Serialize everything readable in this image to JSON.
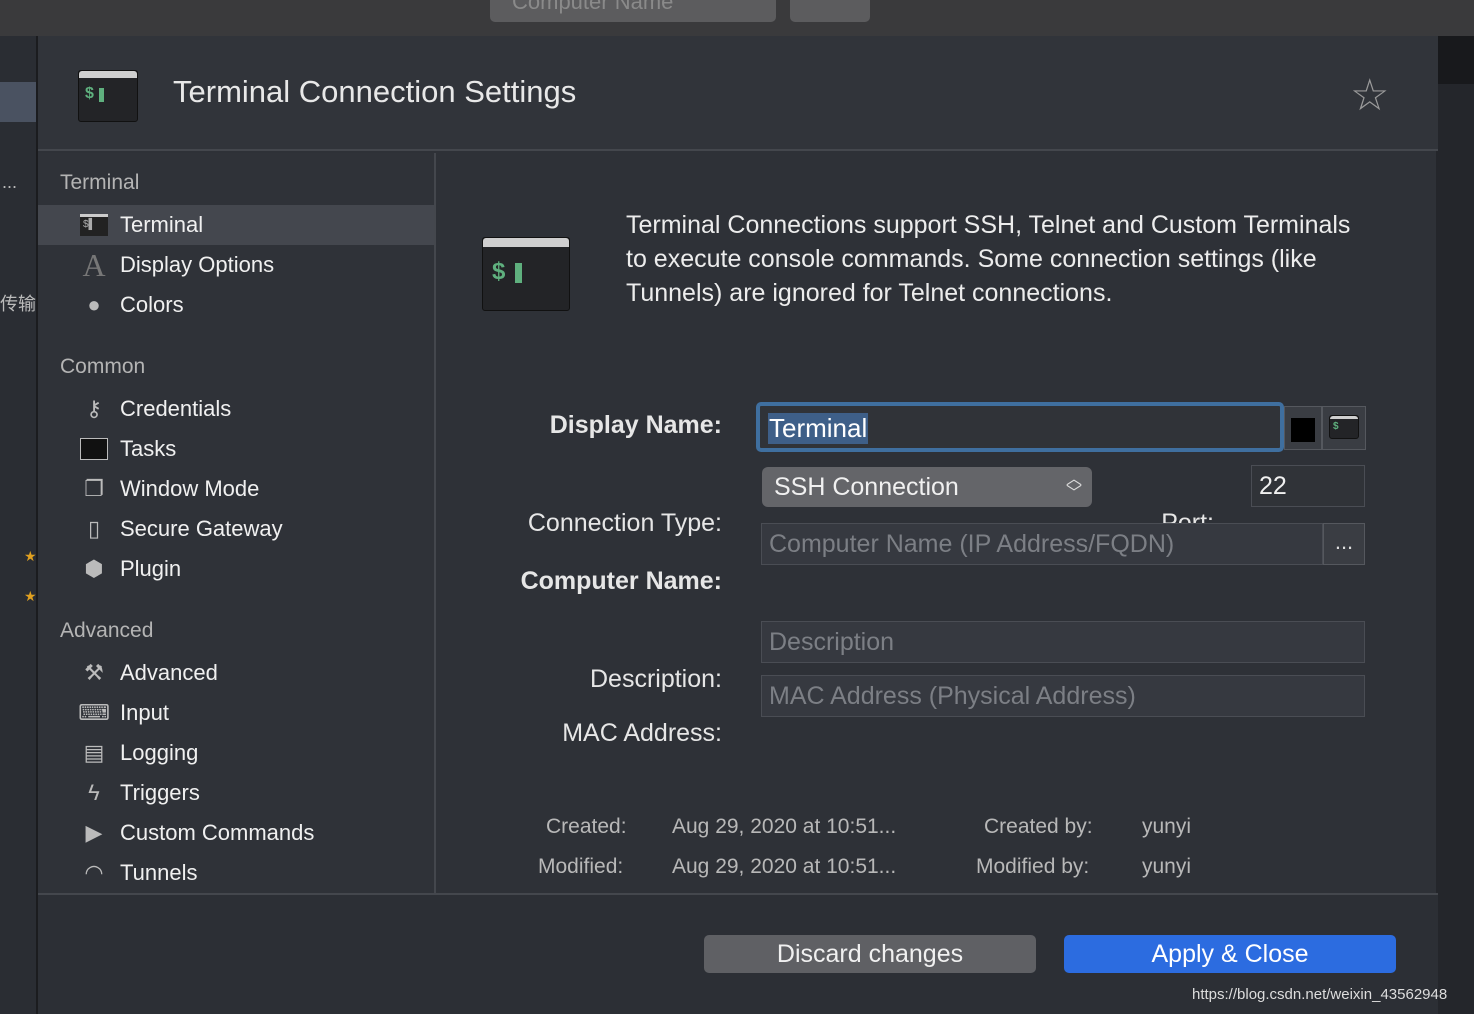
{
  "background": {
    "top_field_text": "Computer Name",
    "left_strip_ellipsis": "...",
    "left_strip_text": "传输",
    "star_glyph": "★"
  },
  "header": {
    "title": "Terminal Connection Settings",
    "favorite_icon": "star-outline-icon",
    "icon_glyph": "$"
  },
  "sidebar": {
    "sections": [
      {
        "title": "Terminal",
        "items": [
          {
            "label": "Terminal",
            "icon": "terminal-icon",
            "selected": true
          },
          {
            "label": "Display Options",
            "icon": "font-icon"
          },
          {
            "label": "Colors",
            "icon": "colors-icon"
          }
        ]
      },
      {
        "title": "Common",
        "items": [
          {
            "label": "Credentials",
            "icon": "key-icon"
          },
          {
            "label": "Tasks",
            "icon": "tasks-icon"
          },
          {
            "label": "Window Mode",
            "icon": "window-icon"
          },
          {
            "label": "Secure Gateway",
            "icon": "gateway-icon"
          },
          {
            "label": "Plugin",
            "icon": "plugin-icon"
          }
        ]
      },
      {
        "title": "Advanced",
        "items": [
          {
            "label": "Advanced",
            "icon": "tools-icon"
          },
          {
            "label": "Input",
            "icon": "keyboard-icon"
          },
          {
            "label": "Logging",
            "icon": "logging-icon"
          },
          {
            "label": "Triggers",
            "icon": "triggers-icon"
          },
          {
            "label": "Custom Commands",
            "icon": "custom-commands-icon"
          },
          {
            "label": "Tunnels",
            "icon": "tunnels-icon"
          }
        ]
      }
    ]
  },
  "main": {
    "description": "Terminal Connections support SSH, Telnet and Custom Terminals to execute console commands. Some connection settings (like Tunnels) are ignored for Telnet connections.",
    "display_name_label": "Display Name:",
    "display_name_value": "Terminal",
    "connection_type_label": "Connection Type:",
    "connection_type_value": "SSH Connection",
    "port_label": "Port:",
    "port_value": "22",
    "computer_name_label": "Computer Name:",
    "computer_name_placeholder": "Computer Name (IP Address/FQDN)",
    "browse_label": "...",
    "description_label": "Description:",
    "description_placeholder": "Description",
    "mac_label": "MAC Address:",
    "mac_placeholder": "MAC Address (Physical Address)",
    "created_label": "Created:",
    "created_value": "Aug 29, 2020 at 10:51...",
    "modified_label": "Modified:",
    "modified_value": "Aug 29, 2020 at 10:51...",
    "created_by_label": "Created by:",
    "created_by_value": "yunyi",
    "modified_by_label": "Modified by:",
    "modified_by_value": "yunyi"
  },
  "footer": {
    "discard_label": "Discard changes",
    "apply_label": "Apply & Close",
    "accent": "#2c6ce0"
  },
  "watermark": "https://blog.csdn.net/weixin_43562948"
}
